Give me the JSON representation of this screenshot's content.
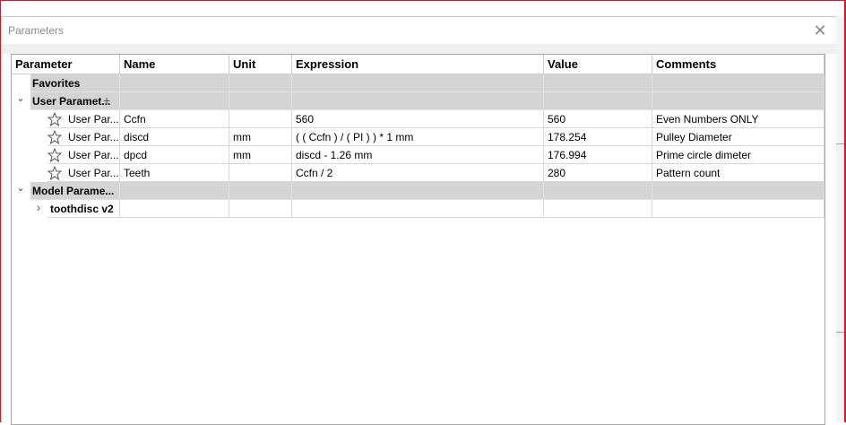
{
  "window": {
    "title": "Parameters",
    "close_glyph": "✕"
  },
  "columns": [
    "Parameter",
    "Name",
    "Unit",
    "Expression",
    "Value",
    "Comments"
  ],
  "groups": {
    "favorites": "Favorites",
    "user_params": "User Paramet...",
    "model_params": "Model Parame...",
    "chevron_open": "⌄",
    "chevron_closed": "›",
    "add_glyph": "+"
  },
  "user_parameters": [
    {
      "type": "User Par...",
      "name": "Ccfn",
      "unit": "",
      "expression": "560",
      "value": "560",
      "comment": "Even Numbers ONLY"
    },
    {
      "type": "User Par...",
      "name": "discd",
      "unit": "mm",
      "expression": "( ( Ccfn ) / ( PI ) ) * 1 mm",
      "value": "178.254",
      "comment": "Pulley Diameter"
    },
    {
      "type": "User Par...",
      "name": "dpcd",
      "unit": "mm",
      "expression": "discd - 1.26 mm",
      "value": "176.994",
      "comment": "Prime circle dimeter"
    },
    {
      "type": "User Par...",
      "name": "Teeth",
      "unit": "",
      "expression": "Ccfn / 2",
      "value": "280",
      "comment": "Pattern count"
    }
  ],
  "model_children": [
    {
      "label": "toothdisc v2"
    }
  ],
  "icons": {
    "star": "star-outline-icon",
    "close": "close-icon",
    "expand": "chevron-icon",
    "add": "add-icon"
  }
}
